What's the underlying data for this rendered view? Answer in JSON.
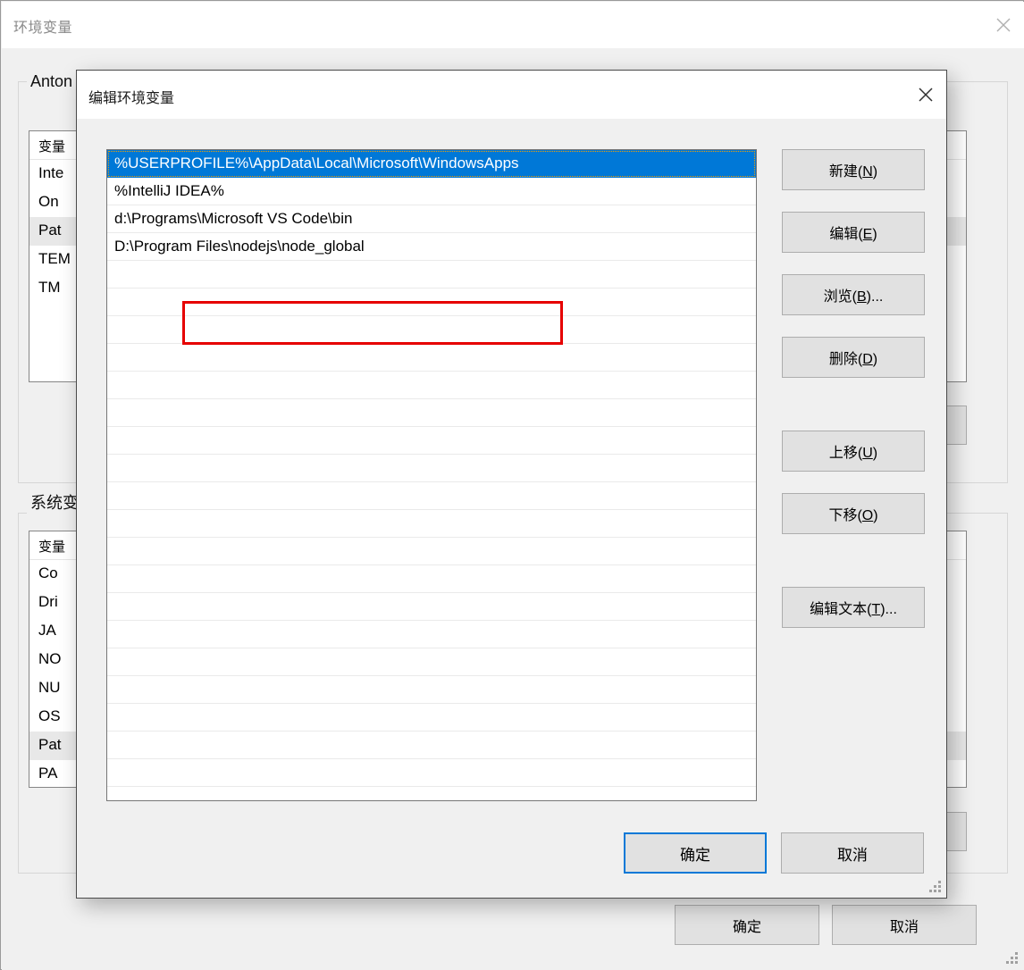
{
  "background_window": {
    "title": "环境变量",
    "close_icon": "close-icon",
    "user_section": {
      "group_label": "Anton",
      "column_header": "变量",
      "rows": [
        {
          "label": "Inte",
          "selected": false
        },
        {
          "label": "On",
          "selected": false
        },
        {
          "label": "Pat",
          "selected": true
        },
        {
          "label": "TEM",
          "selected": false
        },
        {
          "label": "TM",
          "selected": false
        }
      ]
    },
    "system_section": {
      "group_label": "系统变",
      "column_header": "变量",
      "rows": [
        {
          "label": "Co",
          "selected": false
        },
        {
          "label": "Dri",
          "selected": false
        },
        {
          "label": "JA",
          "selected": false
        },
        {
          "label": "NO",
          "selected": false
        },
        {
          "label": "NU",
          "selected": false
        },
        {
          "label": "OS",
          "selected": false
        },
        {
          "label": "Pat",
          "selected": true
        },
        {
          "label": "PA",
          "selected": false
        }
      ],
      "scrollbar": {
        "up_arrow_icon": "chevron-up-icon",
        "down_arrow_icon": "chevron-down-icon"
      }
    },
    "ok_label": "确定",
    "cancel_label": "取消"
  },
  "modal": {
    "title": "编辑环境变量",
    "close_icon": "close-icon",
    "path_entries": [
      {
        "value": "%USERPROFILE%\\AppData\\Local\\Microsoft\\WindowsApps",
        "selected": true,
        "annotated": false
      },
      {
        "value": "%IntelliJ IDEA%",
        "selected": false,
        "annotated": false
      },
      {
        "value": "d:\\Programs\\Microsoft VS Code\\bin",
        "selected": false,
        "annotated": false
      },
      {
        "value": "D:\\Program Files\\nodejs\\node_global",
        "selected": false,
        "annotated": true
      }
    ],
    "side_buttons": [
      {
        "label": "新建(N)",
        "accel": "N"
      },
      {
        "label": "编辑(E)",
        "accel": "E"
      },
      {
        "label": "浏览(B)...",
        "accel": "B"
      },
      {
        "label": "删除(D)",
        "accel": "D"
      },
      {
        "label": "上移(U)",
        "accel": "U"
      },
      {
        "label": "下移(O)",
        "accel": "O"
      },
      {
        "label": "编辑文本(T)...",
        "accel": "T"
      }
    ],
    "ok_label": "确定",
    "cancel_label": "取消"
  },
  "colors": {
    "selection_blue": "#0078d7",
    "annotation_red": "#e60000",
    "window_chrome": "#f0f0f0",
    "button_face": "#e1e1e1"
  }
}
